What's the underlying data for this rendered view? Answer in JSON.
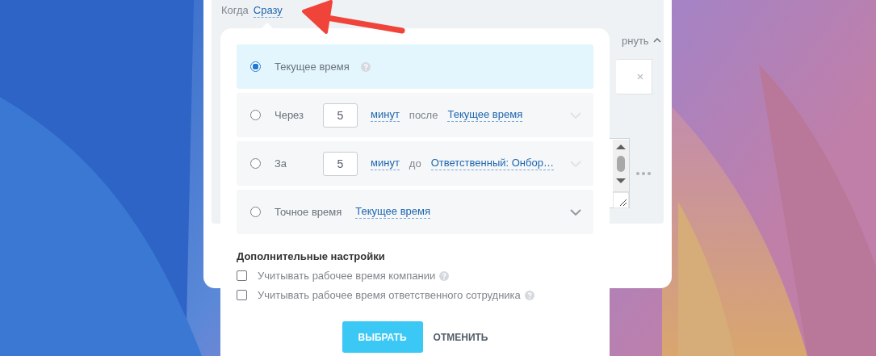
{
  "dialog": {
    "when_label": "Когда",
    "when_value": "Сразу",
    "collapse_label": "рнуть"
  },
  "popup": {
    "options": [
      {
        "kind": "current",
        "selected": true,
        "label": "Текущее время"
      },
      {
        "kind": "offset",
        "selected": false,
        "label": "Через",
        "amount": "5",
        "unit": "минут",
        "relation": "после",
        "target": "Текущее время"
      },
      {
        "kind": "offset",
        "selected": false,
        "label": "За",
        "amount": "5",
        "unit": "минут",
        "relation": "до",
        "target": "Ответственный: Онбор…"
      },
      {
        "kind": "exact",
        "selected": false,
        "label": "Точное время",
        "target": "Текущее время"
      }
    ],
    "settings_title": "Дополнительные настройки",
    "settings": [
      {
        "label": "Учитывать рабочее время компании",
        "checked": false
      },
      {
        "label": "Учитывать рабочее время ответственного сотрудника",
        "checked": false
      }
    ],
    "buttons": [
      {
        "kind": "primary",
        "label": "ВЫБРАТЬ"
      },
      {
        "kind": "secondary",
        "label": "ОТМЕНИТЬ"
      }
    ]
  }
}
